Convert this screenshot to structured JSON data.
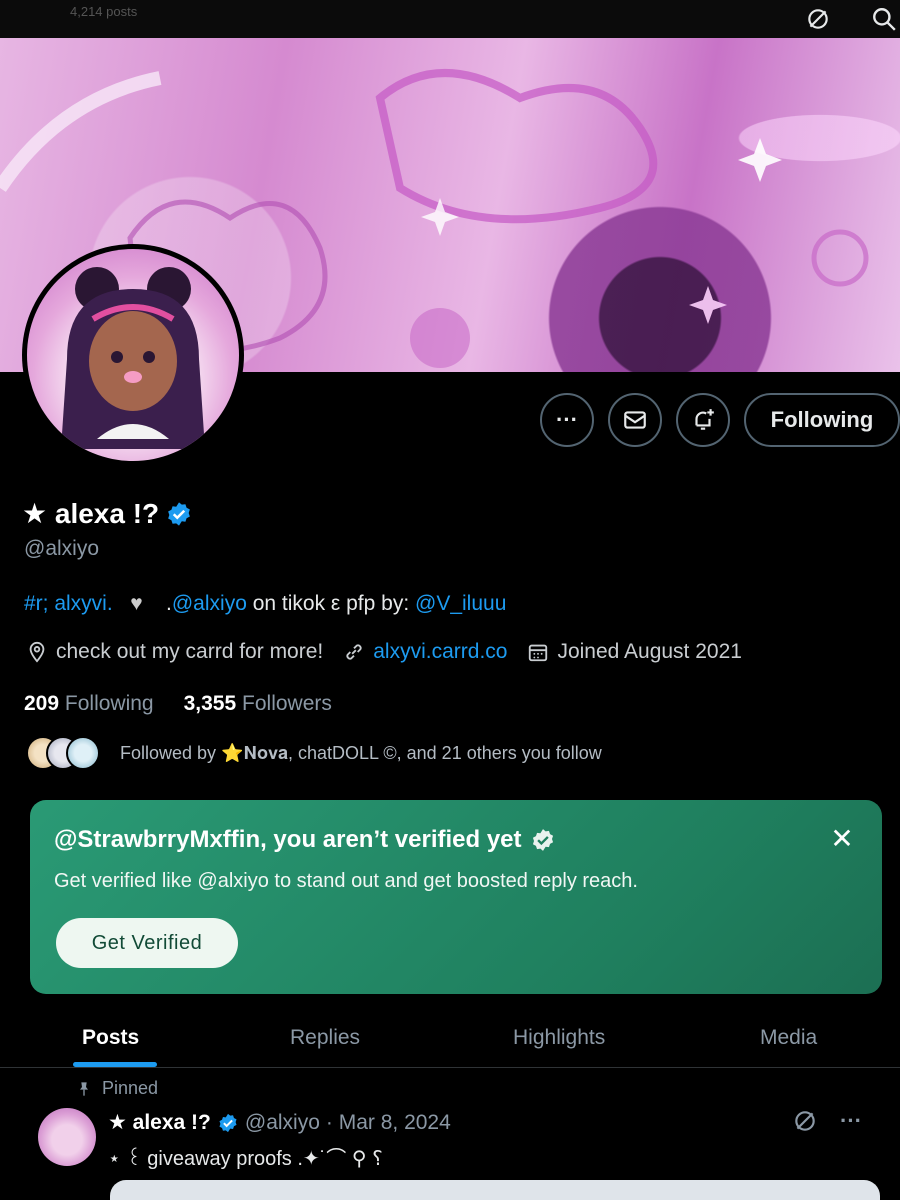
{
  "topbar": {
    "faded_title": "4,214 posts"
  },
  "profile": {
    "display_name": "★ alexa !?",
    "handle": "@alxiyo",
    "bio": {
      "hashtag": "#r; alxyvi.",
      "heart": "♥",
      "mention_prefix": ".",
      "mention": "@alxiyo",
      "mid_text": " on tikok ε pfp by: ",
      "credit": "@V_iluuu"
    },
    "location": "check out my carrd for more!",
    "website": "alxyvi.carrd.co",
    "joined": "Joined August 2021",
    "following_count": "209",
    "following_label": "Following",
    "followers_count": "3,355",
    "followers_label": "Followers",
    "followed_by": "Followed by ⭐𝐍𝐨𝐯𝐚, chatDOLL ©, and 21 others you follow"
  },
  "actions": {
    "more_label": "···",
    "follow_label": "Following"
  },
  "verify_card": {
    "title": "@StrawbrryMxffin, you aren’t verified yet",
    "subtitle": "Get verified like @alxiyo to stand out and get boosted reply reach.",
    "close_label": "✕",
    "button_label": "Get Verified"
  },
  "tabs": [
    {
      "label": "Posts"
    },
    {
      "label": "Replies"
    },
    {
      "label": "Highlights"
    },
    {
      "label": "Media"
    }
  ],
  "pinned_post": {
    "pinned_label": "Pinned",
    "name": "★ alexa !?",
    "handle": "@alxiyo",
    "date": "· Mar 8, 2024",
    "more_label": "···",
    "text": "⋆ ꒰ giveaway proofs .✦˙⌒ ⚲ ؟"
  },
  "colors": {
    "accent": "#1d9bf0",
    "verify_bg": "#1f7f5e",
    "background": "#000000"
  }
}
